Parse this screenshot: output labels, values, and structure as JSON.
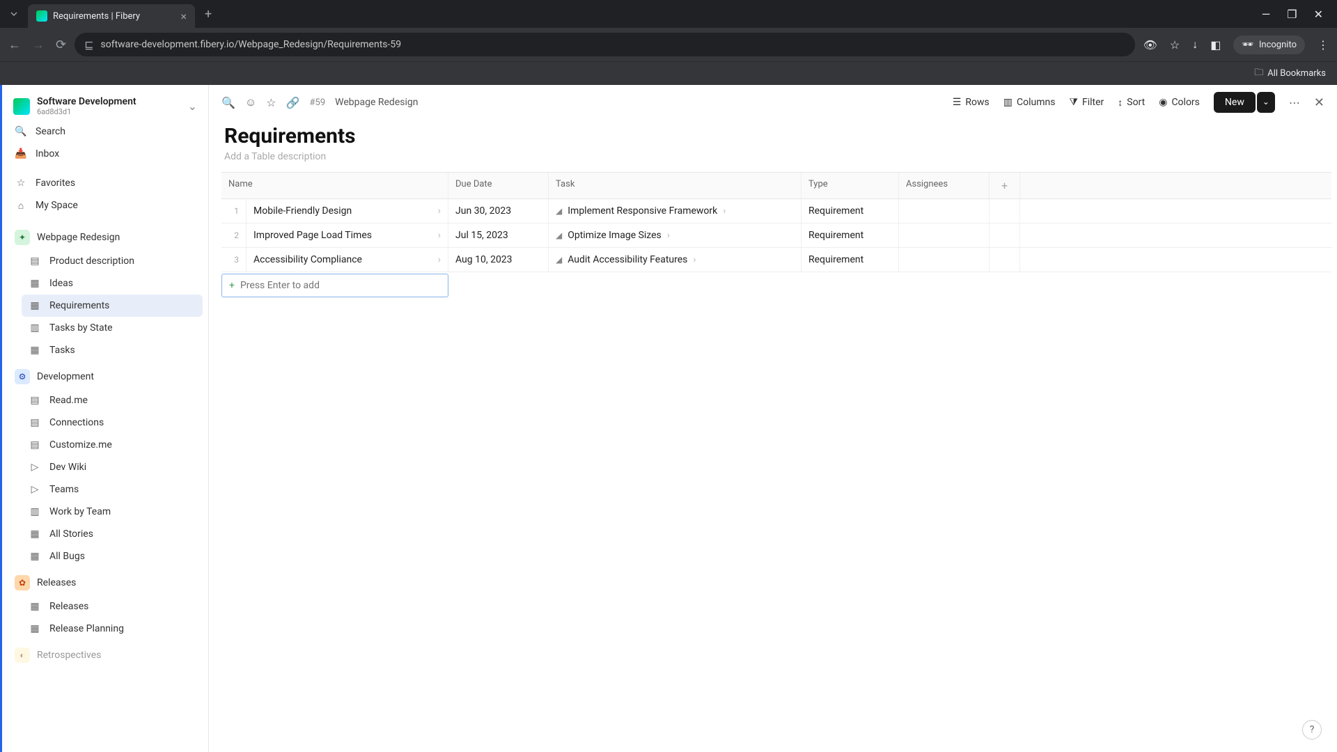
{
  "browser": {
    "tab_title": "Requirements | Fibery",
    "url": "software-development.fibery.io/Webpage_Redesign/Requirements-59",
    "incognito_label": "Incognito",
    "all_bookmarks": "All Bookmarks"
  },
  "workspace": {
    "name": "Software Development",
    "id": "6ad8d3d1"
  },
  "sidebar": {
    "search": "Search",
    "inbox": "Inbox",
    "favorites": "Favorites",
    "my_space": "My Space",
    "sections": [
      {
        "name": "Webpage Redesign",
        "items": [
          "Product description",
          "Ideas",
          "Requirements",
          "Tasks by State",
          "Tasks"
        ],
        "active": "Requirements"
      },
      {
        "name": "Development",
        "items": [
          "Read.me",
          "Connections",
          "Customize.me",
          "Dev Wiki",
          "Teams",
          "Work by Team",
          "All Stories",
          "All Bugs"
        ]
      },
      {
        "name": "Releases",
        "items": [
          "Releases",
          "Release Planning"
        ]
      },
      {
        "name_partial": "Retrospectives"
      }
    ]
  },
  "breadcrumb": {
    "id_prefix": "#59",
    "title": "Webpage Redesign"
  },
  "toolbar": {
    "rows": "Rows",
    "columns": "Columns",
    "filter": "Filter",
    "sort": "Sort",
    "colors": "Colors",
    "new": "New"
  },
  "page": {
    "title": "Requirements",
    "description_placeholder": "Add a Table description"
  },
  "table": {
    "columns": [
      "Name",
      "Due Date",
      "Task",
      "Type",
      "Assignees"
    ],
    "rows": [
      {
        "n": "1",
        "name": "Mobile-Friendly Design",
        "due": "Jun 30, 2023",
        "task": "Implement Responsive Framework",
        "type": "Requirement",
        "assignees": ""
      },
      {
        "n": "2",
        "name": "Improved Page Load Times",
        "due": "Jul 15, 2023",
        "task": "Optimize Image Sizes",
        "type": "Requirement",
        "assignees": ""
      },
      {
        "n": "3",
        "name": "Accessibility Compliance",
        "due": "Aug 10, 2023",
        "task": "Audit Accessibility Features",
        "type": "Requirement",
        "assignees": ""
      }
    ],
    "add_placeholder": "Press Enter to add"
  },
  "help": "?"
}
